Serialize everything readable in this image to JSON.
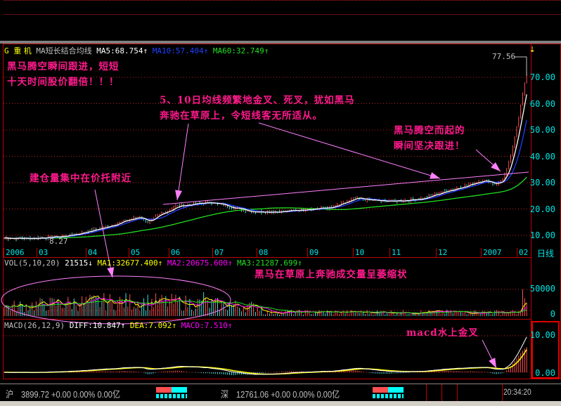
{
  "header": {
    "g": "G",
    "stock_name": "重 机",
    "indicator": "MA短长结合均线",
    "ma5": "MA5:68.754",
    "ma10": "MA10:57.404",
    "ma60": "MA60:32.749",
    "up_arrow": "↑"
  },
  "annotations": {
    "a1_l1": "黑马腾空瞬间跟进，短短",
    "a1_l2": "十天时间股价翻倍！！！",
    "a2_l1": "5、10日均线频繁地金叉、死叉，犹如黑马",
    "a2_l2": "奔驰在草原上，令短线客无所适从。",
    "a3_l1": "黑马腾空而起的",
    "a3_l2": "瞬间坚决跟进！",
    "a4": "建仓量集中在价托附近",
    "a5": "黑马在草原上奔驰成交量呈萎缩状",
    "a6": "macd水上金叉"
  },
  "price_axis": {
    "ticks": [
      "70.00",
      "60.00",
      "50.00",
      "40.00",
      "30.00",
      "20.00",
      "10.00"
    ],
    "high_label": "77.56",
    "low_label": "8.27",
    "period": "日线"
  },
  "months": [
    "2006",
    "03",
    "04",
    "05",
    "06",
    "07",
    "08",
    "09",
    "10",
    "11",
    "12",
    "2007",
    "02"
  ],
  "vol": {
    "label": "VOL(5,10,20)",
    "value": "21515",
    "down_arrow": "↓",
    "ma1": "MA1:32677.400",
    "ma2": "MA2:20675.600",
    "ma3": "MA3:21287.699",
    "ticks": [
      "50000",
      "0"
    ]
  },
  "macd": {
    "label": "MACD(26,12,9)",
    "diff": "DIFF:10.847",
    "dea": "DEA:7.092",
    "macd": "MACD:7.510",
    "ticks": [
      "10.00",
      "0.00"
    ]
  },
  "status": {
    "sh_label": "沪",
    "sh_text": "3899.72 +0.00 0.00% 0.00亿",
    "sz_label": "深",
    "sz_text": "12761.06 +0.00 0.00% 0.00亿",
    "time": "20:34:20"
  },
  "colors": {
    "up": "#ff5050",
    "down": "#40e0e0",
    "ma5": "#ffffff",
    "ma10": "#2040ff",
    "ma60": "#20e020",
    "annotation": "#ff1a8c",
    "pointer": "#ff80ff"
  },
  "chart_data": {
    "type": "line",
    "x_unit": "trading day",
    "price_keypoints": [
      [
        0,
        9
      ],
      [
        12,
        8.8
      ],
      [
        28,
        9.5
      ],
      [
        36,
        10.5
      ],
      [
        50,
        13
      ],
      [
        60,
        15.5
      ],
      [
        68,
        17
      ],
      [
        72,
        15
      ],
      [
        78,
        18
      ],
      [
        86,
        21
      ],
      [
        96,
        22
      ],
      [
        104,
        22.5
      ],
      [
        112,
        21
      ],
      [
        124,
        19
      ],
      [
        140,
        19
      ],
      [
        152,
        20
      ],
      [
        164,
        20.5
      ],
      [
        176,
        24
      ],
      [
        188,
        23
      ],
      [
        196,
        23
      ],
      [
        210,
        24
      ],
      [
        222,
        27
      ],
      [
        232,
        29
      ],
      [
        240,
        31
      ],
      [
        246,
        29.5
      ],
      [
        250,
        31
      ],
      [
        254,
        40
      ],
      [
        258,
        55
      ],
      [
        262,
        72
      ]
    ],
    "ylim": [
      5,
      80
    ]
  }
}
